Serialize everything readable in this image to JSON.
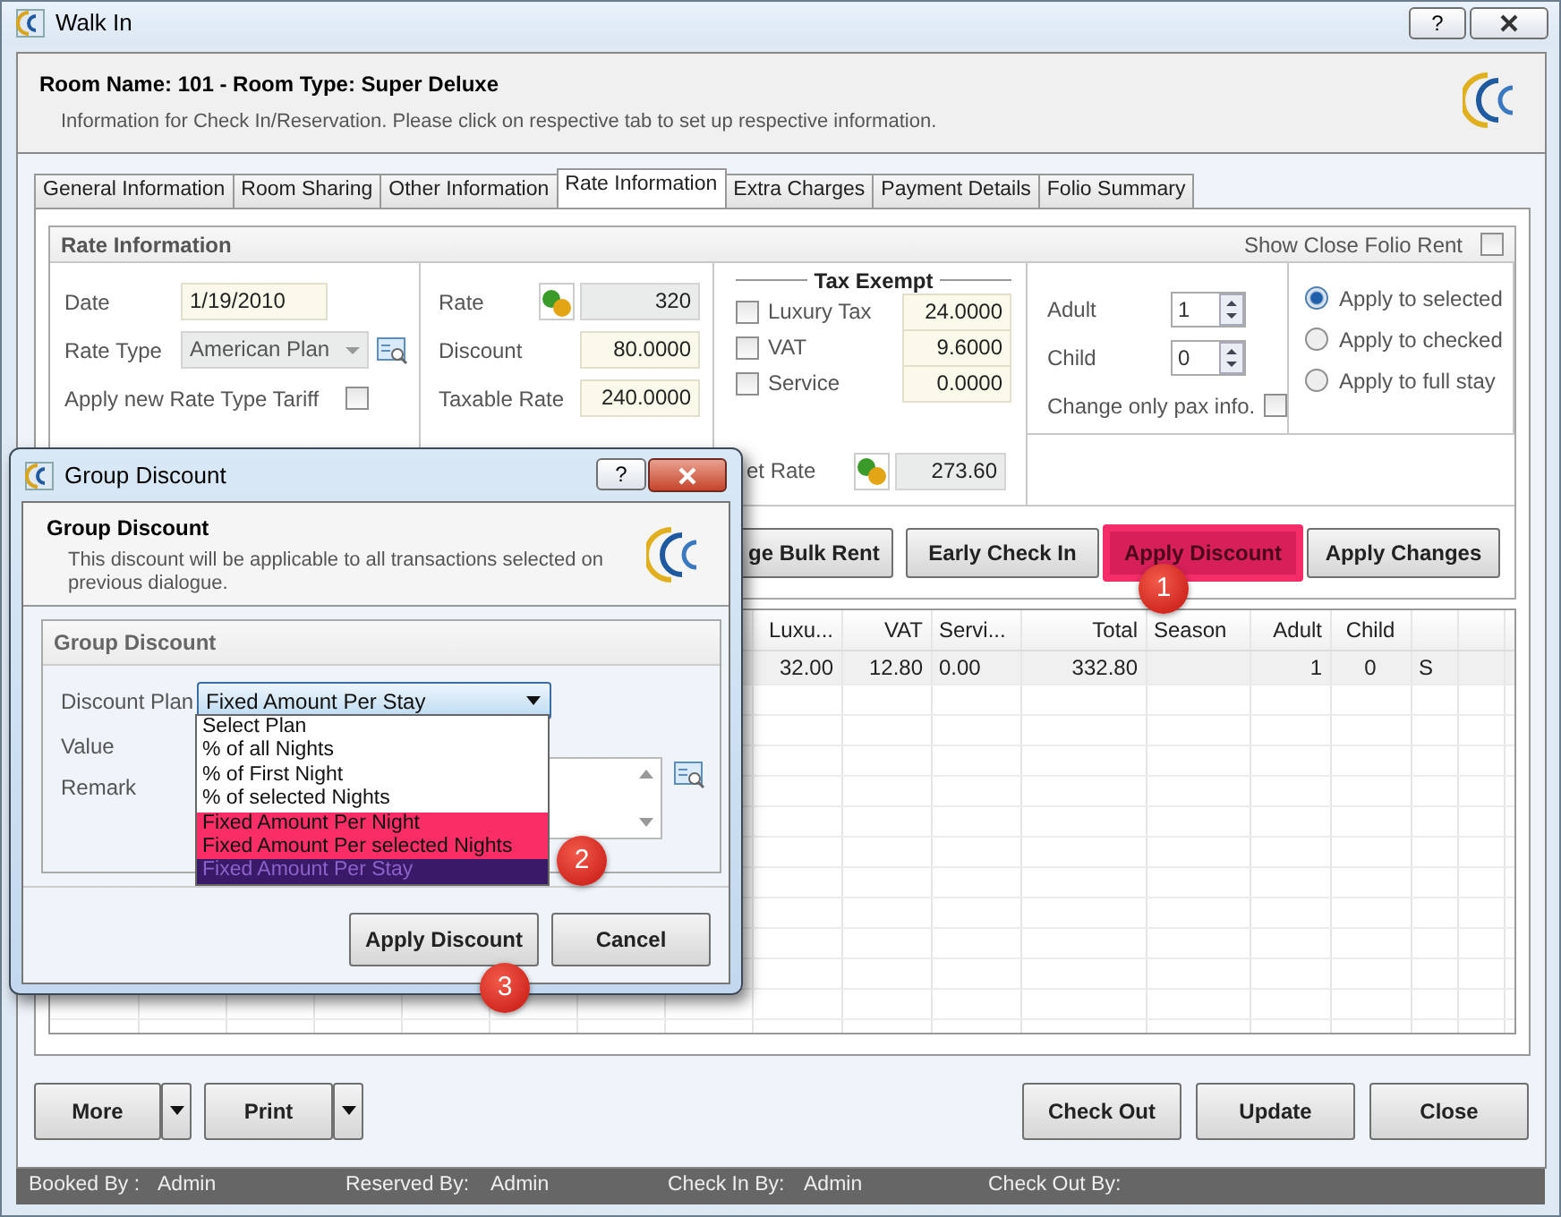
{
  "window": {
    "title": "Walk In",
    "help": "?"
  },
  "header": {
    "title": "Room Name: 101 - Room Type: Super Deluxe",
    "subtitle": "Information for Check In/Reservation. Please click on respective tab to set up respective information."
  },
  "tabs": [
    {
      "label": "General Information",
      "selected": false
    },
    {
      "label": "Room Sharing",
      "selected": false
    },
    {
      "label": "Other Information",
      "selected": false
    },
    {
      "label": "Rate Information",
      "selected": true
    },
    {
      "label": "Extra Charges",
      "selected": false
    },
    {
      "label": "Payment Details",
      "selected": false
    },
    {
      "label": "Folio Summary",
      "selected": false
    }
  ],
  "rate_panel": {
    "title": "Rate Information",
    "show_close_folio": {
      "label": "Show Close Folio Rent",
      "checked": false
    },
    "date": {
      "label": "Date",
      "value": "1/19/2010"
    },
    "rate_type": {
      "label": "Rate Type",
      "value": "American Plan"
    },
    "apply_tariff": {
      "label": "Apply new Rate Type Tariff",
      "checked": false
    },
    "rate": {
      "label": "Rate",
      "value": "320"
    },
    "discount": {
      "label": "Discount",
      "value": "80.0000"
    },
    "taxable_rate": {
      "label": "Taxable Rate",
      "value": "240.0000"
    },
    "tax_exempt": {
      "title": "Tax Exempt",
      "items": [
        {
          "label": "Luxury Tax",
          "checked": false,
          "value": "24.0000"
        },
        {
          "label": "VAT",
          "checked": false,
          "value": "9.6000"
        },
        {
          "label": "Service",
          "checked": false,
          "value": "0.0000"
        }
      ]
    },
    "net_rate": {
      "label": "et Rate",
      "value": "273.60"
    },
    "adult": {
      "label": "Adult",
      "value": "1"
    },
    "child": {
      "label": "Child",
      "value": "0"
    },
    "pax_only": {
      "label": "Change only pax info.",
      "checked": false
    },
    "apply_options": [
      {
        "label": "Apply to selected",
        "selected": true
      },
      {
        "label": "Apply to checked",
        "selected": false
      },
      {
        "label": "Apply to full stay",
        "selected": false
      }
    ]
  },
  "action_buttons": [
    {
      "label": "ge Bulk Rent",
      "highlighted": false
    },
    {
      "label": "Early Check In",
      "highlighted": false
    },
    {
      "label": "Apply Discount",
      "highlighted": true
    },
    {
      "label": "Apply Changes",
      "highlighted": false
    }
  ],
  "grid": {
    "columns": [
      "Luxu...",
      "VAT",
      "Servi...",
      "Total",
      "Season",
      "Adult",
      "Child"
    ],
    "rows": [
      {
        "luxu": "32.00",
        "vat": "12.80",
        "servi": "0.00",
        "total": "332.80",
        "adult": "1",
        "child": "0",
        "column_8": "S"
      }
    ]
  },
  "bottom_buttons": [
    {
      "label": "More",
      "dropdown": true
    },
    {
      "label": "Print",
      "dropdown": true
    },
    {
      "label": "Check Out",
      "dropdown": false
    },
    {
      "label": "Update",
      "dropdown": false
    },
    {
      "label": "Close",
      "dropdown": false
    }
  ],
  "status_bar": [
    {
      "label": "Booked By :",
      "value": "Admin"
    },
    {
      "label": "Reserved By:",
      "value": "Admin"
    },
    {
      "label": "Check In By:",
      "value": "Admin"
    },
    {
      "label": "Check Out By:"
    }
  ],
  "dialog": {
    "title": "Group Discount",
    "help": "?",
    "header_title": "Group Discount",
    "description": "This discount will be applicable to all transactions selected on previous dialogue.",
    "group_title": "Group Discount",
    "discount_plan": {
      "label": "Discount Plan",
      "value": "Fixed Amount Per Stay",
      "expanded": true,
      "options": [
        {
          "label": "Select Plan",
          "selected": false,
          "highlighted": false
        },
        {
          "label": "% of all Nights",
          "selected": false,
          "highlighted": false
        },
        {
          "label": "% of First Night",
          "selected": false,
          "highlighted": false
        },
        {
          "label": "% of selected Nights",
          "selected": false,
          "highlighted": false
        },
        {
          "label": "Fixed Amount Per Night",
          "selected": false,
          "highlighted": true
        },
        {
          "label": "Fixed Amount Per selected Nights",
          "selected": false,
          "highlighted": true
        },
        {
          "label": "Fixed Amount Per Stay",
          "selected": true,
          "highlighted": true
        }
      ]
    },
    "value_label": "Value",
    "remark_label": "Remark",
    "buttons": [
      {
        "label": "Apply Discount"
      },
      {
        "label": "Cancel"
      }
    ]
  },
  "callouts": [
    "1",
    "2",
    "3"
  ]
}
